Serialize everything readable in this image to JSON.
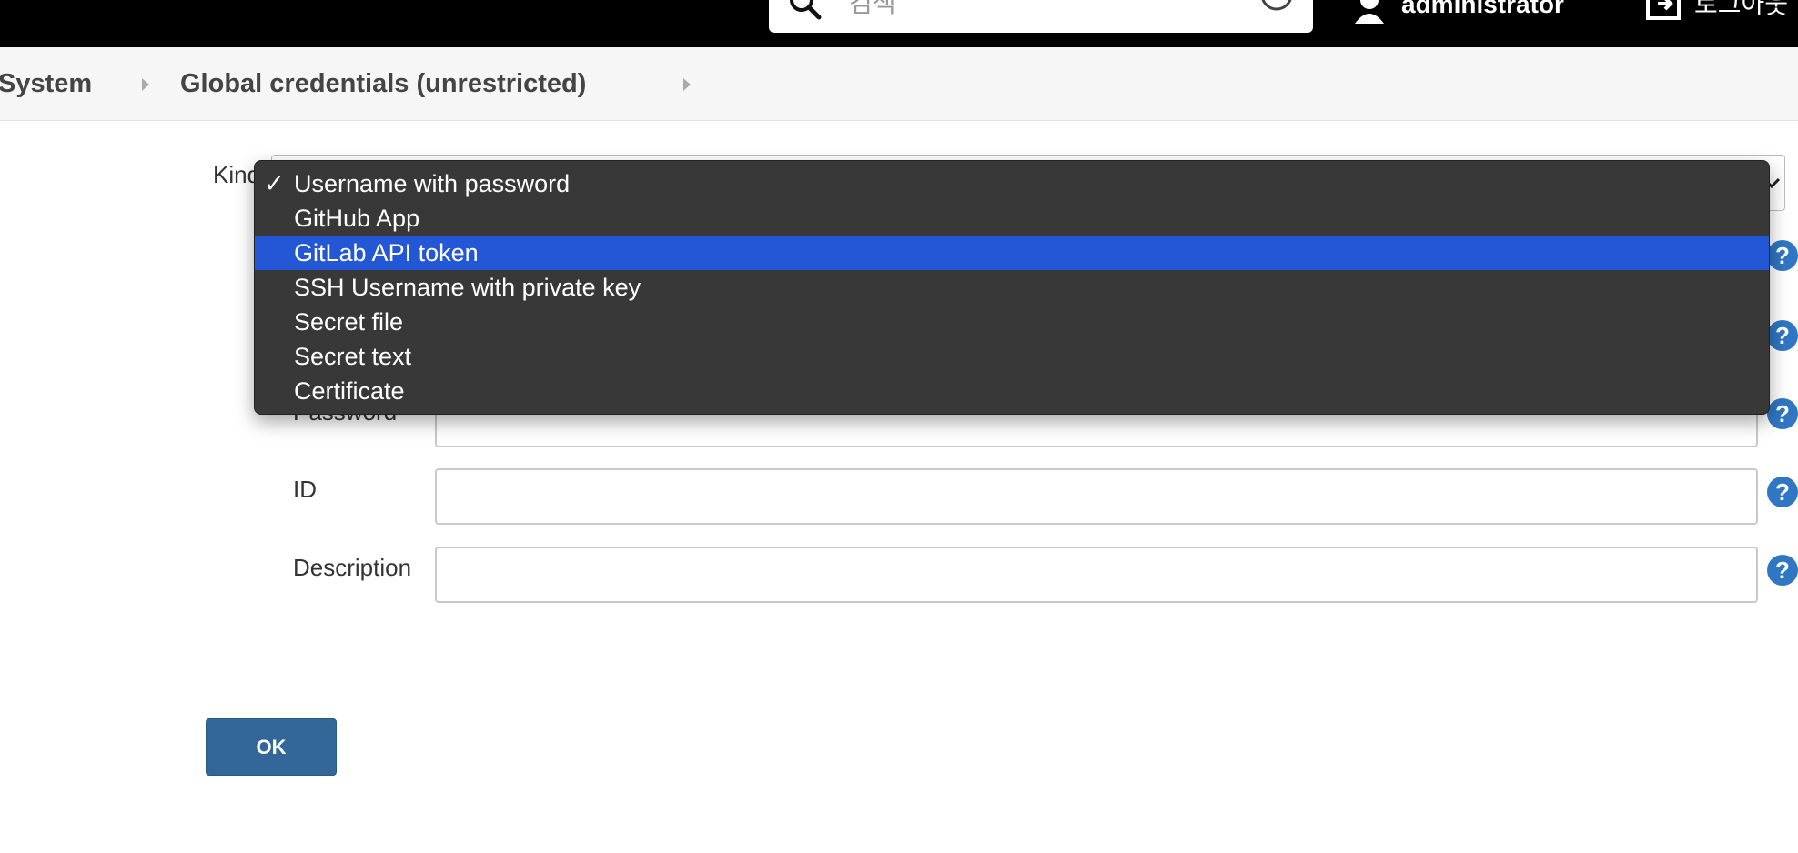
{
  "header": {
    "search": {
      "placeholder": "검색"
    },
    "user": {
      "name": "administrator"
    },
    "logout": {
      "label": "로그아웃"
    }
  },
  "breadcrumb": {
    "items": [
      {
        "label": "System"
      },
      {
        "label": "Global credentials (unrestricted)"
      }
    ]
  },
  "form": {
    "kind": {
      "label": "Kind",
      "options": [
        {
          "label": "Username with password",
          "checked": true
        },
        {
          "label": "GitHub App"
        },
        {
          "label": "GitLab API token",
          "highlighted": true
        },
        {
          "label": "SSH Username with private key"
        },
        {
          "label": "Secret file"
        },
        {
          "label": "Secret text"
        },
        {
          "label": "Certificate"
        }
      ],
      "check_mark": "✓"
    },
    "fields": {
      "password": {
        "label": "Password",
        "value": ""
      },
      "id": {
        "label": "ID",
        "value": ""
      },
      "description": {
        "label": "Description",
        "value": ""
      }
    },
    "ok_label": "OK"
  },
  "colors": {
    "accent": "#336699",
    "highlight": "#2457d6",
    "help": "#2f76c3"
  },
  "icons": [
    "search-icon",
    "help-circle-icon",
    "user-icon",
    "logout-icon",
    "chevron-right-icon",
    "chevron-down-icon",
    "help-icon",
    "check-icon"
  ]
}
